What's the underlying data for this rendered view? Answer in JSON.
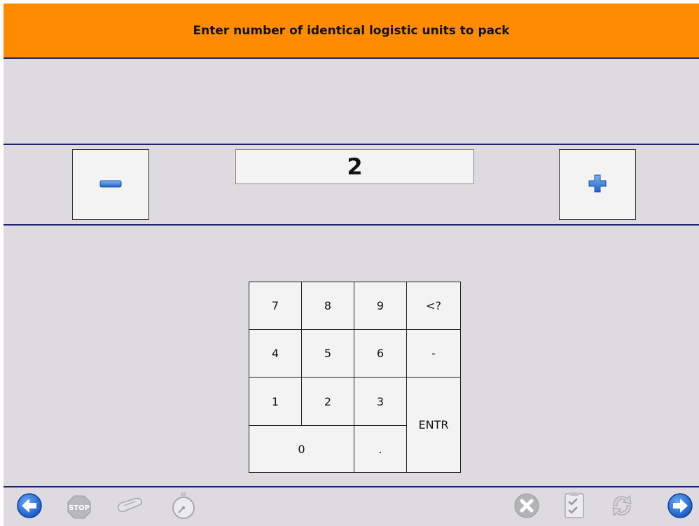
{
  "header": {
    "title": "Enter number of identical logistic units to pack"
  },
  "quantity": {
    "value": "2"
  },
  "stepper": {
    "minus_icon": "minus-icon",
    "plus_icon": "plus-icon"
  },
  "keypad": {
    "k7": "7",
    "k8": "8",
    "k9": "9",
    "back": "<?",
    "k4": "4",
    "k5": "5",
    "k6": "6",
    "minus": "-",
    "k1": "1",
    "k2": "2",
    "k3": "3",
    "enter": "ENTR",
    "k0": "0",
    "dot": "."
  },
  "toolbar": {
    "back_icon": "arrow-left-icon",
    "stop_label": "STOP",
    "scanner_icon": "scanner-icon",
    "timer_icon": "stopwatch-icon",
    "cancel_icon": "cancel-icon",
    "checklist_icon": "checklist-icon",
    "refresh_icon": "refresh-icon",
    "next_icon": "arrow-right-icon"
  },
  "colors": {
    "header_bg": "#ff8c00",
    "panel_bg": "#dedbe0",
    "divider": "#1f2470",
    "accent_blue": "#1e6fd9"
  }
}
